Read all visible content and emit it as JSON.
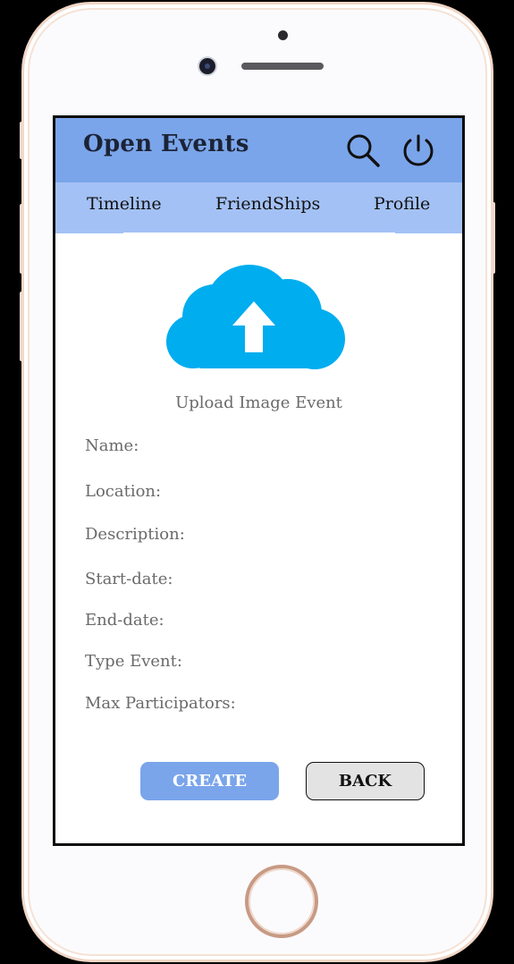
{
  "app": {
    "title": "Open Events"
  },
  "header": {
    "search_icon": "search-icon",
    "power_icon": "power-icon"
  },
  "tabs": [
    {
      "label": "Timeline"
    },
    {
      "label": "FriendShips"
    },
    {
      "label": "Profile"
    }
  ],
  "upload": {
    "icon": "cloud-upload-icon",
    "label": "Upload Image Event",
    "color": "#00adef"
  },
  "form": {
    "fields": [
      {
        "label": "Name:",
        "value": ""
      },
      {
        "label": "Location:",
        "value": ""
      },
      {
        "label": "Description:",
        "value": ""
      },
      {
        "label": "Start-date:",
        "value": ""
      },
      {
        "label": "End-date:",
        "value": ""
      },
      {
        "label": "Type Event:",
        "value": ""
      },
      {
        "label": "Max Participators:",
        "value": ""
      }
    ]
  },
  "actions": {
    "create_label": "CREATE",
    "back_label": "BACK"
  },
  "colors": {
    "header": "#7aa5ea",
    "tabs": "#a3c1f5",
    "accent": "#7aa5ea"
  }
}
